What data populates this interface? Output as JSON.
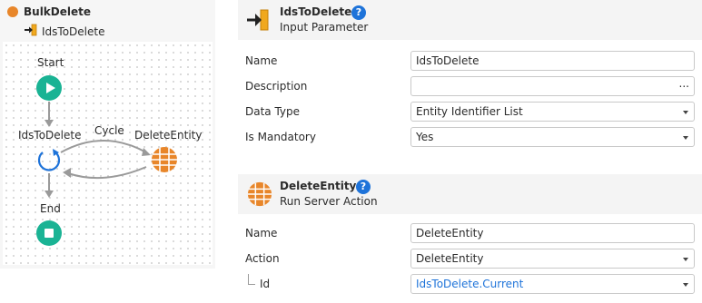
{
  "tree": {
    "root_label": "BulkDelete",
    "child_label": "IdsToDelete"
  },
  "flow": {
    "start_label": "Start",
    "loop_label": "IdsToDelete",
    "cycle_label": "Cycle",
    "action_label": "DeleteEntity",
    "end_label": "End"
  },
  "input_panel": {
    "title": "IdsToDelete",
    "subtitle": "Input Parameter",
    "help": "?",
    "rows": [
      {
        "label": "Name",
        "value": "IdsToDelete"
      },
      {
        "label": "Description",
        "value": ""
      },
      {
        "label": "Data Type",
        "value": "Entity Identifier List"
      },
      {
        "label": "Is Mandatory",
        "value": "Yes"
      }
    ],
    "ellipsis": "..."
  },
  "action_panel": {
    "title": "DeleteEntity",
    "subtitle": "Run Server Action",
    "help": "?",
    "rows": [
      {
        "label": "Name",
        "value": "DeleteEntity"
      },
      {
        "label": "Action",
        "value": "DeleteEntity"
      },
      {
        "label": "Id",
        "value_link": "IdsToDelete",
        "value_rest": ".Current"
      }
    ]
  },
  "colors": {
    "start_end_green": "#1ab394",
    "action_orange": "#e8862a",
    "help_blue": "#1e73d9",
    "cycle_blue": "#1e73d9"
  },
  "icons": {
    "root": "orange-circle-icon",
    "input_param": "input-arrow-icon",
    "loop": "loop-cycle-icon",
    "server_action": "globe-grid-icon",
    "start": "play-icon",
    "end": "stop-icon"
  }
}
